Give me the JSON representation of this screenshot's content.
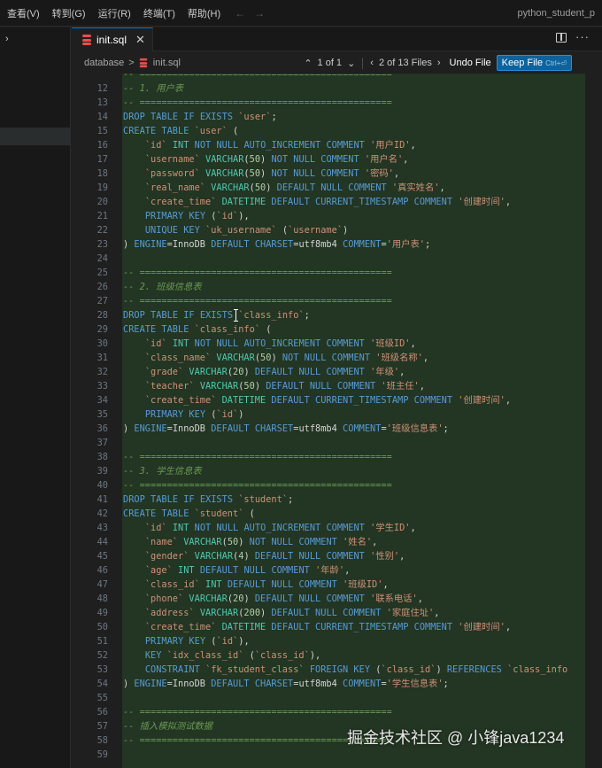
{
  "menubar": {
    "items": [
      "查看(V)",
      "转到(G)",
      "运行(R)",
      "终端(T)",
      "帮助(H)"
    ],
    "nav_back": "←",
    "nav_forward": "→",
    "window_title": "python_student_p"
  },
  "sidebar": {
    "chevron": "›"
  },
  "tab": {
    "icon": "database-icon",
    "label": "init.sql",
    "close": "✕"
  },
  "breadcrumb": {
    "folder": "database",
    "separator": ">",
    "file": "init.sql"
  },
  "find_bar": {
    "up": "⌃",
    "count": "1 of 1",
    "down": "⌄",
    "prev_file": "‹",
    "files_count": "2 of 13 Files",
    "next_file": "›",
    "undo_label": "Undo File",
    "keep_label": "Keep File",
    "keep_hint": "Ctrl+⏎"
  },
  "editor_actions": {
    "more": "···"
  },
  "watermark": "掘金技术社区 @ 小锋java1234",
  "colors": {
    "background": "#1f1f1f",
    "diff_added_bg": "#233523",
    "keyword": "#569cd6",
    "comment": "#6a9955",
    "string": "#ce9178",
    "type": "#4ec9b0",
    "number": "#b5cea8",
    "accent": "#0e639c"
  },
  "code": {
    "top_partial": "-- ==============================================",
    "lines": [
      {
        "n": "12",
        "t": "-- 1. 用户表"
      },
      {
        "n": "13",
        "t": "-- =============================================="
      },
      {
        "n": "14",
        "t": "DROP TABLE IF EXISTS `user`;"
      },
      {
        "n": "15",
        "t": "CREATE TABLE `user` ("
      },
      {
        "n": "16",
        "t": "    `id` INT NOT NULL AUTO_INCREMENT COMMENT '用户ID',"
      },
      {
        "n": "17",
        "t": "    `username` VARCHAR(50) NOT NULL COMMENT '用户名',"
      },
      {
        "n": "18",
        "t": "    `password` VARCHAR(50) NOT NULL COMMENT '密码',"
      },
      {
        "n": "19",
        "t": "    `real_name` VARCHAR(50) DEFAULT NULL COMMENT '真实姓名',"
      },
      {
        "n": "20",
        "t": "    `create_time` DATETIME DEFAULT CURRENT_TIMESTAMP COMMENT '创建时间',"
      },
      {
        "n": "21",
        "t": "    PRIMARY KEY (`id`),"
      },
      {
        "n": "22",
        "t": "    UNIQUE KEY `uk_username` (`username`)"
      },
      {
        "n": "23",
        "t": ") ENGINE=InnoDB DEFAULT CHARSET=utf8mb4 COMMENT='用户表';"
      },
      {
        "n": "24",
        "t": ""
      },
      {
        "n": "25",
        "t": "-- =============================================="
      },
      {
        "n": "26",
        "t": "-- 2. 班级信息表"
      },
      {
        "n": "27",
        "t": "-- =============================================="
      },
      {
        "n": "28",
        "t": "DROP TABLE IF EXISTS `class_info`;"
      },
      {
        "n": "29",
        "t": "CREATE TABLE `class_info` ("
      },
      {
        "n": "30",
        "t": "    `id` INT NOT NULL AUTO_INCREMENT COMMENT '班级ID',"
      },
      {
        "n": "31",
        "t": "    `class_name` VARCHAR(50) NOT NULL COMMENT '班级名称',"
      },
      {
        "n": "32",
        "t": "    `grade` VARCHAR(20) DEFAULT NULL COMMENT '年级',"
      },
      {
        "n": "33",
        "t": "    `teacher` VARCHAR(50) DEFAULT NULL COMMENT '班主任',"
      },
      {
        "n": "34",
        "t": "    `create_time` DATETIME DEFAULT CURRENT_TIMESTAMP COMMENT '创建时间',"
      },
      {
        "n": "35",
        "t": "    PRIMARY KEY (`id`)"
      },
      {
        "n": "36",
        "t": ") ENGINE=InnoDB DEFAULT CHARSET=utf8mb4 COMMENT='班级信息表';"
      },
      {
        "n": "37",
        "t": ""
      },
      {
        "n": "38",
        "t": "-- =============================================="
      },
      {
        "n": "39",
        "t": "-- 3. 学生信息表"
      },
      {
        "n": "40",
        "t": "-- =============================================="
      },
      {
        "n": "41",
        "t": "DROP TABLE IF EXISTS `student`;"
      },
      {
        "n": "42",
        "t": "CREATE TABLE `student` ("
      },
      {
        "n": "43",
        "t": "    `id` INT NOT NULL AUTO_INCREMENT COMMENT '学生ID',"
      },
      {
        "n": "44",
        "t": "    `name` VARCHAR(50) NOT NULL COMMENT '姓名',"
      },
      {
        "n": "45",
        "t": "    `gender` VARCHAR(4) DEFAULT NULL COMMENT '性别',"
      },
      {
        "n": "46",
        "t": "    `age` INT DEFAULT NULL COMMENT '年龄',"
      },
      {
        "n": "47",
        "t": "    `class_id` INT DEFAULT NULL COMMENT '班级ID',"
      },
      {
        "n": "48",
        "t": "    `phone` VARCHAR(20) DEFAULT NULL COMMENT '联系电话',"
      },
      {
        "n": "49",
        "t": "    `address` VARCHAR(200) DEFAULT NULL COMMENT '家庭住址',"
      },
      {
        "n": "50",
        "t": "    `create_time` DATETIME DEFAULT CURRENT_TIMESTAMP COMMENT '创建时间',"
      },
      {
        "n": "51",
        "t": "    PRIMARY KEY (`id`),"
      },
      {
        "n": "52",
        "t": "    KEY `idx_class_id` (`class_id`),"
      },
      {
        "n": "53",
        "t": "    CONSTRAINT `fk_student_class` FOREIGN KEY (`class_id`) REFERENCES `class_info"
      },
      {
        "n": "54",
        "t": ") ENGINE=InnoDB DEFAULT CHARSET=utf8mb4 COMMENT='学生信息表';"
      },
      {
        "n": "55",
        "t": ""
      },
      {
        "n": "56",
        "t": "-- =============================================="
      },
      {
        "n": "57",
        "t": "-- 插入模拟测试数据"
      },
      {
        "n": "58",
        "t": "-- =============================================="
      },
      {
        "n": "59",
        "t": ""
      }
    ]
  }
}
